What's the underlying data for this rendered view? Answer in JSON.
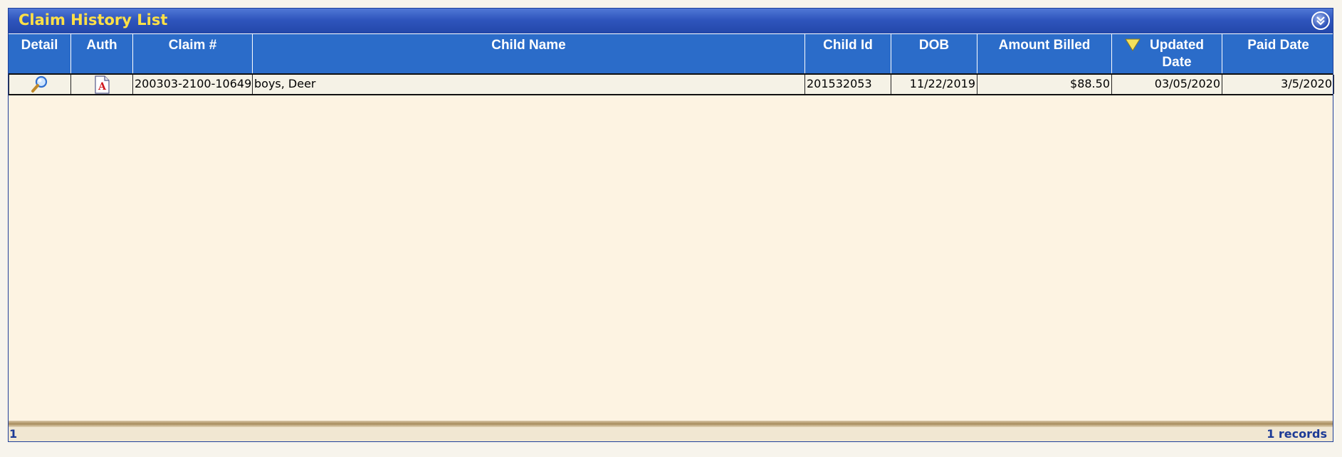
{
  "panel": {
    "title": "Claim History List",
    "collapse_icon": "double-chevron-down-icon"
  },
  "table": {
    "columns": [
      {
        "key": "detail",
        "label": "Detail"
      },
      {
        "key": "auth",
        "label": "Auth"
      },
      {
        "key": "claim",
        "label": "Claim #"
      },
      {
        "key": "child_name",
        "label": "Child Name"
      },
      {
        "key": "child_id",
        "label": "Child Id"
      },
      {
        "key": "dob",
        "label": "DOB"
      },
      {
        "key": "amount_billed",
        "label": "Amount Billed"
      },
      {
        "key": "updated_date",
        "label": "Updated Date",
        "sorted": "descending",
        "sort_icon": "sort-desc-triangle-icon"
      },
      {
        "key": "paid_date",
        "label": "Paid Date"
      }
    ],
    "rows": [
      {
        "detail_icon": "magnifier-icon",
        "auth_icon": "pdf-document-icon",
        "claim": "200303-2100-10649",
        "child_name": "boys, Deer",
        "child_id": "201532053",
        "dob": "11/22/2019",
        "amount_billed": "$88.50",
        "updated_date": "03/05/2020",
        "paid_date": "3/5/2020"
      }
    ]
  },
  "footer": {
    "page": "1",
    "records": "1 records"
  },
  "colors": {
    "title_text": "#ffe046",
    "title_bar": "#2f55bd",
    "header_bg": "#2b6cc9",
    "body_bg": "#fdf3e2",
    "footer_text": "#1c3a96"
  }
}
